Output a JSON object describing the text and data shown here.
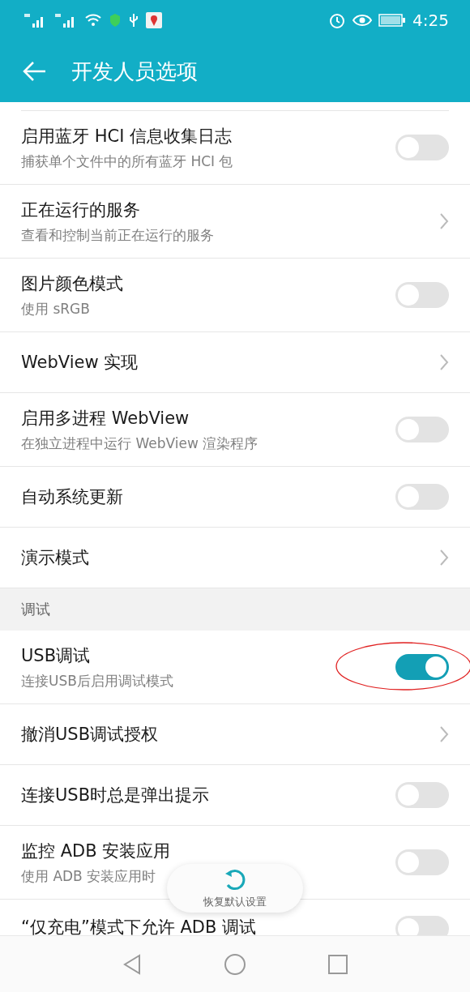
{
  "status_bar": {
    "time": "4:25"
  },
  "app_bar": {
    "title": "开发人员选项"
  },
  "sections": [
    {
      "items": [
        {
          "kind": "switch",
          "title": "启用蓝牙 HCI 信息收集日志",
          "subtitle": "捕获单个文件中的所有蓝牙 HCI 包",
          "on": false
        },
        {
          "kind": "link",
          "title": "正在运行的服务",
          "subtitle": "查看和控制当前正在运行的服务"
        },
        {
          "kind": "switch",
          "title": "图片颜色模式",
          "subtitle": "使用 sRGB",
          "on": false
        },
        {
          "kind": "link",
          "title": "WebView 实现"
        },
        {
          "kind": "switch",
          "title": "启用多进程 WebView",
          "subtitle": "在独立进程中运行 WebView 渲染程序",
          "on": false
        },
        {
          "kind": "switch",
          "title": "自动系统更新",
          "on": false
        },
        {
          "kind": "link",
          "title": "演示模式"
        }
      ]
    },
    {
      "header": "调试",
      "items": [
        {
          "kind": "switch",
          "title": "USB调试",
          "subtitle": "连接USB后启用调试模式",
          "on": true,
          "highlighted": true
        },
        {
          "kind": "link",
          "title": "撤消USB调试授权"
        },
        {
          "kind": "switch",
          "title": "连接USB时总是弹出提示",
          "on": false
        },
        {
          "kind": "switch",
          "title": "监控 ADB 安装应用",
          "subtitle": "使用 ADB 安装应用时",
          "on": false
        },
        {
          "kind": "switch",
          "title": "“仅充电”模式下允许 ADB 调试",
          "on": false
        }
      ]
    }
  ],
  "toast": {
    "label": "恢复默认设置"
  }
}
